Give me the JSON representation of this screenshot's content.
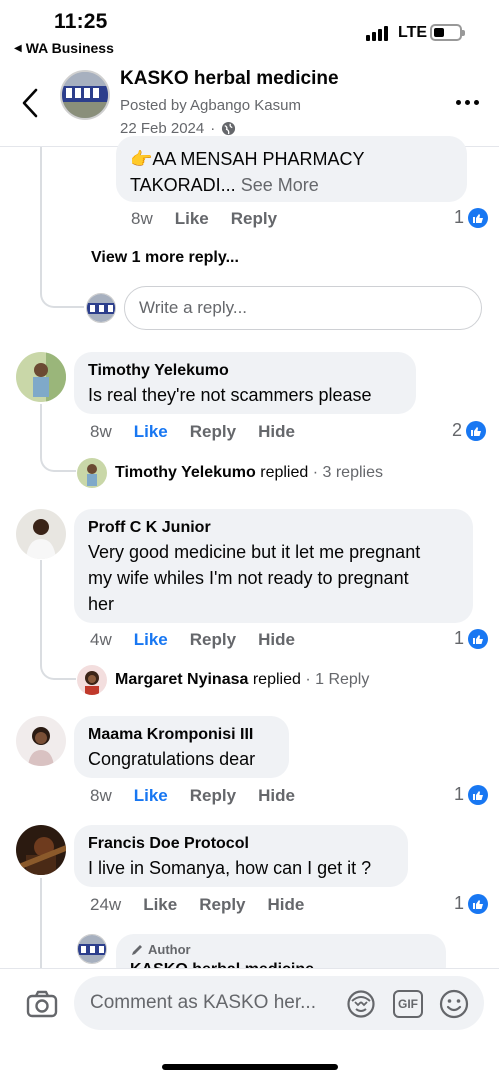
{
  "status_bar": {
    "time": "11:25",
    "back_app": "WA Business",
    "network": "LTE",
    "battery_level": 0.4
  },
  "header": {
    "page_name": "KASKO herbal medicine",
    "posted_by": "Posted by Agbango Kasum",
    "date": "22 Feb 2024",
    "date_separator": "·"
  },
  "thread": {
    "top_comment": {
      "text_line1": "👉AA MENSAH PHARMACY",
      "text_line2": "TAKORADI...",
      "see_more": "See More",
      "ago": "8w",
      "like": "Like",
      "reply": "Reply",
      "reactions": "1"
    },
    "view_more_replies": "View 1 more reply...",
    "write_reply_placeholder": "Write a reply..."
  },
  "comments": [
    {
      "author": "Timothy Yelekumo",
      "text": "Is real they're not scammers please",
      "ago": "8w",
      "like": "Like",
      "reply": "Reply",
      "hide": "Hide",
      "reactions": "2",
      "reply_author": "Timothy Yelekumo",
      "reply_verb": "replied",
      "reply_count": "· 3 replies"
    },
    {
      "author": "Proff C K Junior",
      "text_lines": [
        "Very good medicine but it let me pregnant",
        "my wife whiles I'm not ready to pregnant",
        "her"
      ],
      "ago": "4w",
      "like": "Like",
      "reply": "Reply",
      "hide": "Hide",
      "reactions": "1",
      "reply_author": "Margaret Nyinasa",
      "reply_verb": "replied",
      "reply_count": "· 1 Reply"
    },
    {
      "author": "Maama Kromponisi III",
      "text": "Congratulations dear",
      "ago": "8w",
      "like": "Like",
      "reply": "Reply",
      "hide": "Hide",
      "reactions": "1"
    },
    {
      "author": "Francis Doe Protocol",
      "text": "I live in Somanya, how can I get it ?",
      "ago": "24w",
      "like": "Like",
      "reply": "Reply",
      "hide": "Hide",
      "reactions": "1",
      "nested_badge": "Author",
      "nested_name_partial": "KASKO herbal medicine"
    }
  ],
  "composer": {
    "placeholder": "Comment as KASKO her...",
    "gif": "GIF"
  },
  "colors": {
    "accent": "#1877f2",
    "bubble": "#f0f2f5",
    "muted": "#65676b"
  }
}
